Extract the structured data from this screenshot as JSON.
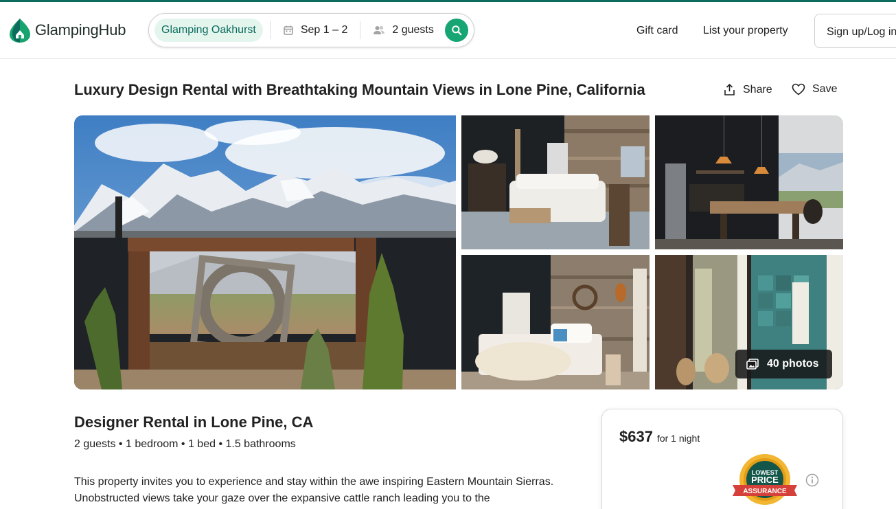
{
  "header": {
    "brand": "GlampingHub",
    "search": {
      "location": "Glamping Oakhurst",
      "dates": "Sep 1 – 2",
      "guests": "2 guests"
    },
    "nav": {
      "gift_card": "Gift card",
      "list_property": "List your property",
      "signup": "Sign up/Log in"
    }
  },
  "listing": {
    "title": "Luxury Design Rental with Breathtaking Mountain Views in Lone Pine, California",
    "share_label": "Share",
    "save_label": "Save",
    "photos_label": "40 photos",
    "subtitle": "Designer Rental in Lone Pine, CA",
    "facts": "2 guests • 1 bedroom • 1 bed • 1.5 bathrooms",
    "description": "This property invites you to experience and stay within the awe inspiring Eastern Mountain Sierras. Unobstructed views take your gaze over the expansive cattle ranch leading you to the"
  },
  "booking": {
    "price": "$637",
    "price_unit": "for 1 night",
    "badge": {
      "line1": "LOWEST",
      "line2": "PRICE",
      "line3": "ASSURANCE"
    }
  },
  "colors": {
    "brand_green": "#0b6b5c",
    "accent_green": "#17a673",
    "chip_bg": "#e4f5ee",
    "badge_gold": "#f2b632",
    "badge_red": "#d6403a"
  },
  "icons": [
    "logo-icon",
    "calendar-icon",
    "guests-icon",
    "search-icon",
    "share-icon",
    "heart-icon",
    "photos-icon",
    "info-icon"
  ]
}
